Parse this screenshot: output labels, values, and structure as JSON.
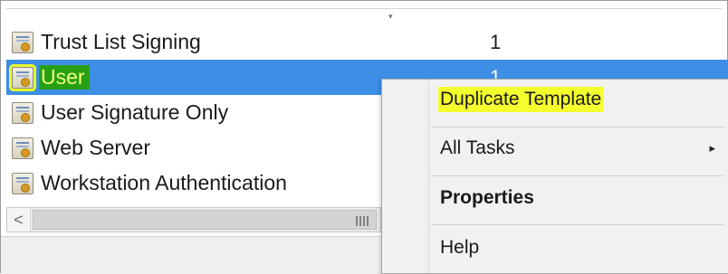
{
  "list": {
    "items": [
      {
        "name": "Trust List Signing",
        "count": "1"
      },
      {
        "name": "User",
        "count": "1",
        "selected": true
      },
      {
        "name": "User Signature Only",
        "count": ""
      },
      {
        "name": "Web Server",
        "count": ""
      },
      {
        "name": "Workstation Authentication",
        "count": ""
      }
    ],
    "icon": "certificate-template-icon"
  },
  "scrollbar": {
    "left_arrow": "<"
  },
  "context_menu": {
    "items": [
      {
        "label": "Duplicate Template",
        "highlighted": true
      },
      {
        "label": "All Tasks",
        "has_submenu": true
      },
      {
        "label": "Properties",
        "bold": true
      },
      {
        "label": "Help"
      }
    ],
    "submenu_arrow": "▸"
  },
  "colors": {
    "selection": "#3d8ee5",
    "highlight_yellow": "#f4ff2e",
    "highlight_green": "#28a016"
  }
}
